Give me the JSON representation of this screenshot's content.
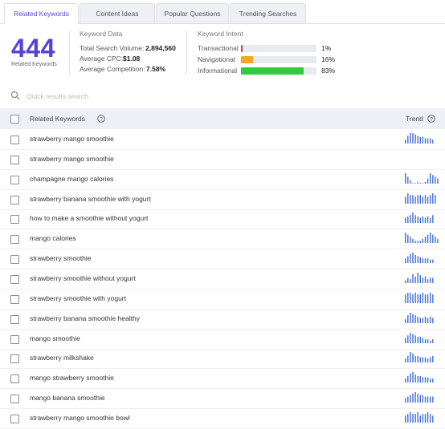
{
  "tabs": [
    {
      "label": "Related Keywords",
      "active": true
    },
    {
      "label": "Content Ideas",
      "active": false
    },
    {
      "label": "Popular Questions",
      "active": false
    },
    {
      "label": "Trending Searches",
      "active": false
    }
  ],
  "summary": {
    "count": "444",
    "count_label": "Related Keywords",
    "keyword_data_title": "Keyword Data",
    "stats": [
      {
        "label": "Total Search Volume:",
        "value": "2,894,560"
      },
      {
        "label": "Average CPC:",
        "value": "$1.08"
      },
      {
        "label": "Average Competition:",
        "value": "7.58%"
      }
    ],
    "intent_title": "Keyword Intent",
    "intents": [
      {
        "label": "Transactional",
        "pct": "1%",
        "value": 1,
        "color": "#e53935"
      },
      {
        "label": "Navigational",
        "pct": "16%",
        "value": 16,
        "color": "#f5a623"
      },
      {
        "label": "Informational",
        "pct": "83%",
        "value": 83,
        "color": "#2ecc40"
      }
    ]
  },
  "search": {
    "placeholder": "Quick results search",
    "value": ""
  },
  "table": {
    "col_keyword": "Related Keywords",
    "col_trend": "Trend",
    "accent_color": "#3f6fd8",
    "rows": [
      {
        "keyword": "strawberry mango smoothie",
        "trend": [
          3,
          6,
          8,
          8,
          7,
          6,
          5,
          5,
          4,
          4,
          4,
          3
        ]
      },
      {
        "keyword": "strawberry mango smoothie",
        "trend": []
      },
      {
        "keyword": "champagne mango calories",
        "trend": [
          6,
          4,
          2,
          0,
          0,
          1,
          0,
          0,
          1,
          3,
          6,
          5,
          4,
          3
        ]
      },
      {
        "keyword": "strawberry banana smoothie with yogurt",
        "trend": [
          4,
          6,
          5,
          5,
          4,
          5,
          5,
          4,
          5,
          4,
          5,
          6,
          5
        ]
      },
      {
        "keyword": "how to make a smoothie without yogurt",
        "trend": [
          4,
          5,
          6,
          8,
          6,
          5,
          4,
          5,
          4,
          5,
          4,
          6
        ]
      },
      {
        "keyword": "mango calories",
        "trend": [
          5,
          4,
          3,
          2,
          1,
          1,
          1,
          2,
          3,
          4,
          5,
          4,
          3,
          2
        ]
      },
      {
        "keyword": "strawberry smoothie",
        "trend": [
          4,
          6,
          8,
          9,
          7,
          6,
          5,
          4,
          4,
          4,
          3,
          3
        ]
      },
      {
        "keyword": "strawberry smoothie without yogurt",
        "trend": [
          2,
          4,
          3,
          7,
          5,
          8,
          6,
          4,
          5,
          3,
          4,
          4
        ]
      },
      {
        "keyword": "strawberry smoothie with yogurt",
        "trend": [
          5,
          6,
          6,
          5,
          6,
          5,
          5,
          6,
          5,
          5,
          6,
          5
        ]
      },
      {
        "keyword": "strawberry banana smoothie healthy",
        "trend": [
          3,
          6,
          8,
          7,
          6,
          5,
          4,
          4,
          5,
          4,
          5,
          4
        ]
      },
      {
        "keyword": "mango smoothie",
        "trend": [
          4,
          6,
          8,
          7,
          6,
          5,
          5,
          4,
          3,
          3,
          2,
          3
        ]
      },
      {
        "keyword": "strawberry milkshake",
        "trend": [
          3,
          5,
          8,
          7,
          5,
          5,
          4,
          4,
          4,
          3,
          4,
          5
        ]
      },
      {
        "keyword": "mango strawberry smoothie",
        "trend": [
          3,
          5,
          7,
          8,
          6,
          5,
          5,
          4,
          4,
          4,
          3,
          3
        ]
      },
      {
        "keyword": "mango banana smoothie",
        "trend": [
          3,
          4,
          5,
          6,
          7,
          6,
          5,
          5,
          4,
          4,
          4,
          4
        ]
      },
      {
        "keyword": "strawberry mango smoothie bowl",
        "trend": [
          4,
          5,
          6,
          5,
          5,
          6,
          4,
          5,
          5,
          6,
          5,
          4
        ]
      }
    ]
  }
}
